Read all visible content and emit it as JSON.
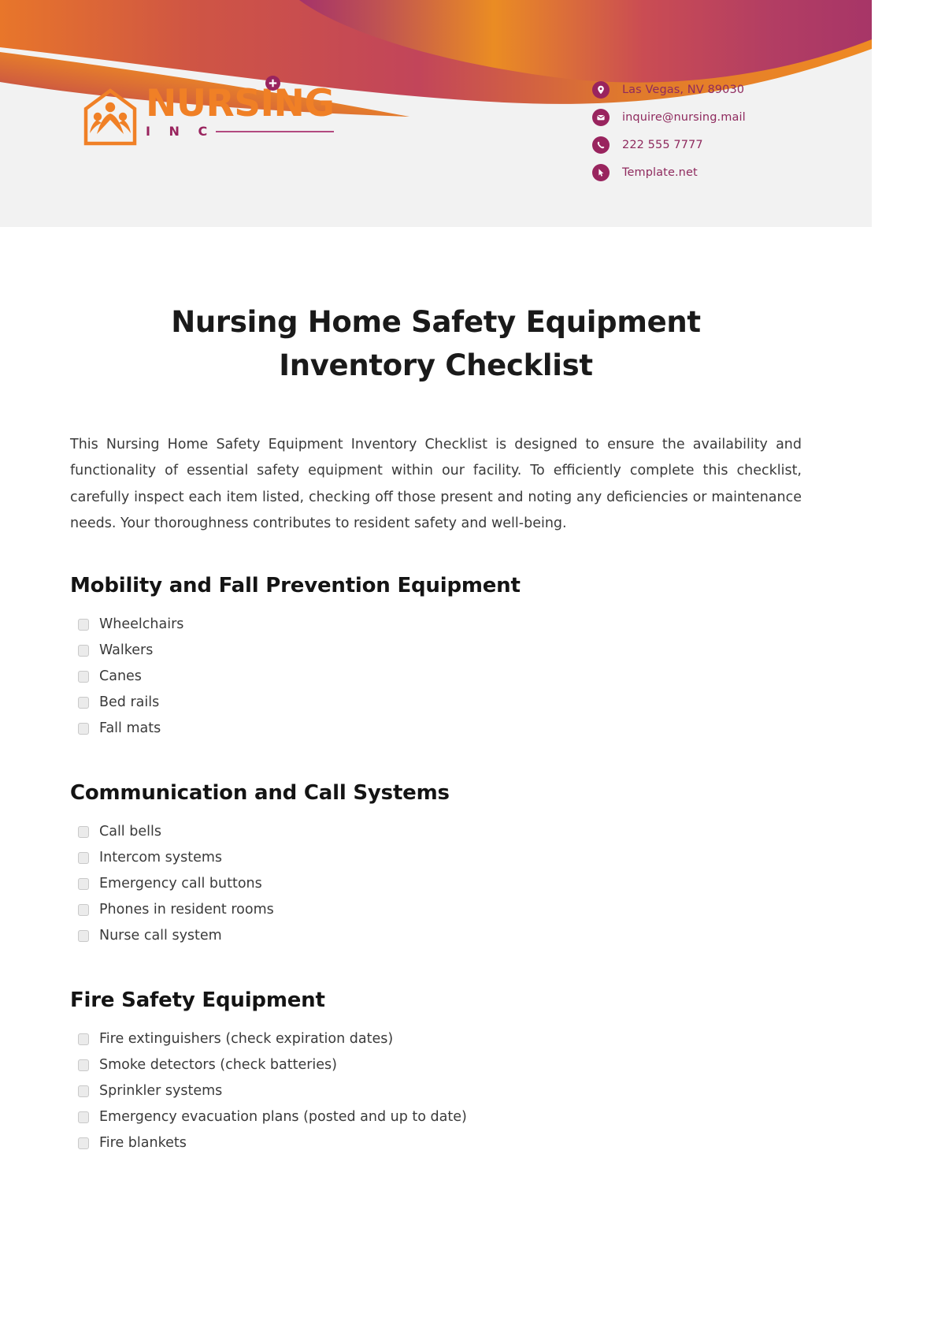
{
  "brand": {
    "name": "NURSING",
    "suffix": "I N C",
    "accent_orange": "#f08026",
    "accent_magenta": "#99245e"
  },
  "header": {
    "contacts": [
      {
        "icon": "location-pin-icon",
        "text": "Las Vegas, NV 89030"
      },
      {
        "icon": "envelope-icon",
        "text": "inquire@nursing.mail"
      },
      {
        "icon": "phone-icon",
        "text": "222 555 7777"
      },
      {
        "icon": "cursor-pointer-icon",
        "text": "Template.net"
      }
    ]
  },
  "document": {
    "title": "Nursing Home Safety Equipment Inventory Checklist",
    "intro": "This Nursing Home Safety Equipment Inventory Checklist is designed to ensure the availability and functionality of essential safety equipment within our facility. To efficiently complete this checklist, carefully inspect each item listed, checking off those present and noting any deficiencies or maintenance needs. Your thoroughness contributes to resident safety and well-being.",
    "sections": [
      {
        "title": "Mobility and Fall Prevention Equipment",
        "items": [
          "Wheelchairs",
          "Walkers",
          "Canes",
          "Bed rails",
          "Fall mats"
        ]
      },
      {
        "title": "Communication and Call Systems",
        "items": [
          "Call bells",
          "Intercom systems",
          "Emergency call buttons",
          "Phones in resident rooms",
          "Nurse call system"
        ]
      },
      {
        "title": "Fire Safety Equipment",
        "items": [
          "Fire extinguishers (check expiration dates)",
          "Smoke detectors (check batteries)",
          "Sprinkler systems",
          "Emergency evacuation plans (posted and up to date)",
          "Fire blankets"
        ]
      }
    ]
  }
}
